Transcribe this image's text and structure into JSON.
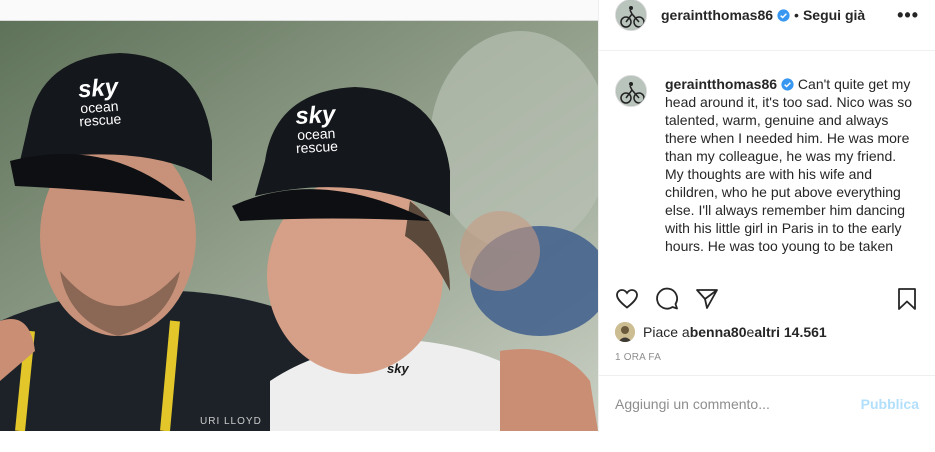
{
  "photo": {
    "cap_brand_left": "sky",
    "cap_sub_left": "ocean\nrescue",
    "cap_brand_right": "sky",
    "cap_sub_right": "ocean\nrescue",
    "shirt_logo": "sky",
    "lanyard_text": "URI LLOYD"
  },
  "header": {
    "username": "geraintthomas86",
    "separator": "•",
    "follow_label": "Segui già",
    "more_label": "•••"
  },
  "caption": {
    "username": "geraintthomas86",
    "text": " Can't quite get my head around it, it's too sad. Nico was so talented, warm, genuine and always there when I needed him. He was more than my colleague, he was my friend.\nMy thoughts are with his wife and children, who he put above everything else. I'll always remember him dancing with his little girl in Paris in to the early hours. He was too young to be taken"
  },
  "likes": {
    "prefix": "Piace a ",
    "user": "benna80",
    "middle": " e ",
    "others": "altri 14.561"
  },
  "timestamp": "1 ORA FA",
  "comment": {
    "placeholder": "Aggiungi un commento...",
    "publish_label": "Pubblica"
  },
  "colors": {
    "verified": "#3897f0",
    "publish_disabled": "#b2dffc",
    "muted": "#8e8e8e"
  }
}
